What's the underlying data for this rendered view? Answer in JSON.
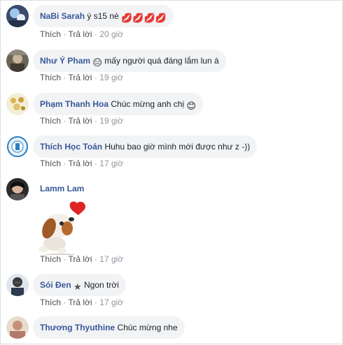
{
  "comments": [
    {
      "author": "NaBi Sarah",
      "text": "ý s15 nè",
      "emoji": "💋💋💋💋",
      "like": "Thích",
      "reply": "Trả lời",
      "time": "20 giờ"
    },
    {
      "author": "Như Ý Pham",
      "emoji": "😑",
      "text": "mấy người quá đáng lắm lun á",
      "like": "Thích",
      "reply": "Trả lời",
      "time": "19 giờ"
    },
    {
      "author": "Phạm Thanh Hoa",
      "text": "Chúc mừng anh chị",
      "emoji": "😊",
      "like": "Thích",
      "reply": "Trả lời",
      "time": "19 giờ"
    },
    {
      "author": "Thích Học Toán",
      "text": "Huhu bao giờ mình mới được như z -))",
      "like": "Thích",
      "reply": "Trả lời",
      "time": "17 giờ"
    },
    {
      "author": "Lamm Lam",
      "sticker": "puppy-heart-sticker",
      "like": "Thích",
      "reply": "Trả lời",
      "time": "17 giờ"
    },
    {
      "author": "Sói Đen",
      "emoji": "★",
      "text": "Ngon trời",
      "like": "Thích",
      "reply": "Trả lời",
      "time": "17 giờ"
    },
    {
      "author": "Thương Thyuthine",
      "text": "Chúc mừng nhe",
      "like": "",
      "reply": "",
      "time": ""
    }
  ],
  "separator": "·",
  "colors": {
    "author": "#385898",
    "bubble": "#f2f3f5",
    "meta": "#90949c",
    "link": "#4b4f56"
  }
}
